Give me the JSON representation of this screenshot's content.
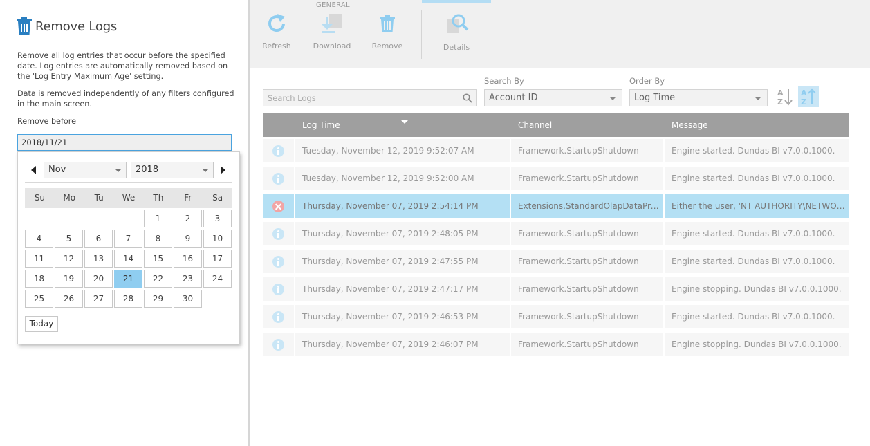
{
  "dialog": {
    "title": "Remove Logs",
    "description": "Remove all log entries that occur before the specified date. Log entries are automatically removed based on the 'Log Entry Maximum Age' setting.",
    "note": "Data is removed independently of any filters configured in the main screen.",
    "remove_before_label": "Remove before",
    "remove_before_value": "2018/11/21"
  },
  "calendar": {
    "month": "Nov",
    "year": "2018",
    "weekdays": [
      "Su",
      "Mo",
      "Tu",
      "We",
      "Th",
      "Fr",
      "Sa"
    ],
    "selected_day": "21",
    "today_label": "Today",
    "days": [
      "",
      "",
      "",
      "",
      "1",
      "2",
      "3",
      "4",
      "5",
      "6",
      "7",
      "8",
      "9",
      "10",
      "11",
      "12",
      "13",
      "14",
      "15",
      "16",
      "17",
      "18",
      "19",
      "20",
      "21",
      "22",
      "23",
      "24",
      "25",
      "26",
      "27",
      "28",
      "29",
      "30"
    ]
  },
  "toolbar": {
    "group_label": "GENERAL",
    "refresh": "Refresh",
    "download": "Download",
    "remove": "Remove",
    "details": "Details"
  },
  "filters": {
    "search_placeholder": "Search Logs",
    "search_by_label": "Search By",
    "search_by_value": "Account ID",
    "order_by_label": "Order By",
    "order_by_value": "Log Time"
  },
  "grid": {
    "columns": {
      "time": "Log Time",
      "channel": "Channel",
      "message": "Message"
    },
    "rows": [
      {
        "level": "info",
        "time": "Tuesday, November 12, 2019 9:52:07 AM",
        "channel": "Framework.StartupShutdown",
        "message": "Engine started. Dundas BI v7.0.0.1000."
      },
      {
        "level": "info",
        "time": "Tuesday, November 12, 2019 9:52:00 AM",
        "channel": "Framework.StartupShutdown",
        "message": "Engine started. Dundas BI v7.0.0.1000."
      },
      {
        "level": "error",
        "selected": true,
        "time": "Thursday, November 07, 2019 2:54:14 PM",
        "channel": "Extensions.StandardOlapDataProvid...",
        "message": "Either the user, 'NT AUTHORITY\\NETWORK S..."
      },
      {
        "level": "info",
        "time": "Thursday, November 07, 2019 2:48:05 PM",
        "channel": "Framework.StartupShutdown",
        "message": "Engine started. Dundas BI v7.0.0.1000."
      },
      {
        "level": "info",
        "time": "Thursday, November 07, 2019 2:47:55 PM",
        "channel": "Framework.StartupShutdown",
        "message": "Engine started. Dundas BI v7.0.0.1000."
      },
      {
        "level": "info",
        "time": "Thursday, November 07, 2019 2:47:17 PM",
        "channel": "Framework.StartupShutdown",
        "message": "Engine stopping.  Dundas BI v7.0.0.1000."
      },
      {
        "level": "info",
        "time": "Thursday, November 07, 2019 2:46:53 PM",
        "channel": "Framework.StartupShutdown",
        "message": "Engine started. Dundas BI v7.0.0.1000."
      },
      {
        "level": "info",
        "time": "Thursday, November 07, 2019 2:46:07 PM",
        "channel": "Framework.StartupShutdown",
        "message": "Engine stopping.  Dundas BI v7.0.0.1000."
      }
    ]
  },
  "colors": {
    "accent": "#4aa3df",
    "selection": "#b4e0f4",
    "calendar_selected": "#8fcdf0",
    "header_gray": "#9f9f9f"
  }
}
